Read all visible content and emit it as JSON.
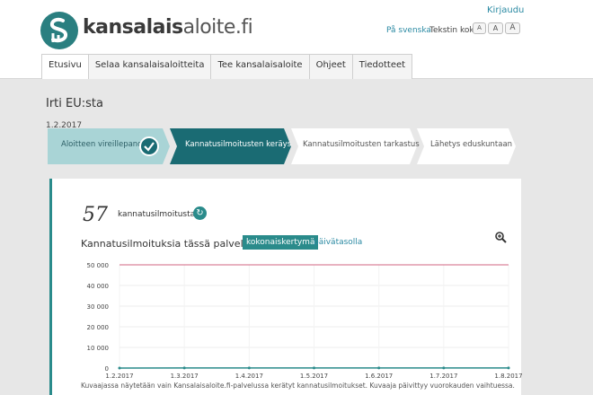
{
  "header": {
    "brand_bold": "kansalais",
    "brand_light": "aloite.fi",
    "login": "Kirjaudu",
    "language_link": "På svenska",
    "text_size_label": "Tekstin koko:",
    "text_size_buttons": [
      "A",
      "A",
      "A"
    ]
  },
  "nav": {
    "items": [
      "Etusivu",
      "Selaa kansalaisaloitteita",
      "Tee kansalaisaloite",
      "Ohjeet",
      "Tiedotteet"
    ]
  },
  "initiative": {
    "title": "Irti EU:sta",
    "date": "1.2.2017"
  },
  "steps": [
    {
      "label": "Aloitteen vireillepano",
      "state": "done"
    },
    {
      "label": "Kannatusilmoitusten keräys",
      "state": "current"
    },
    {
      "label": "Kannatusilmoitusten tarkastus",
      "state": "upcoming"
    },
    {
      "label": "Lähetys eduskuntaan",
      "state": "upcoming"
    }
  ],
  "support": {
    "count": "57",
    "count_label": "kannatusilmoitusta"
  },
  "chart_section": {
    "title": "Kannatusilmoituksia tässä palvelussa 57",
    "tab_active": "kokonaiskertymä",
    "tab_other": "päivätasolla",
    "caption": "Kuvaajassa näytetään vain Kansalaisaloite.fi-palvelussa kerätyt kannatusilmoitukset. Kuvaaja päivittyy vuorokauden vaihtuessa."
  },
  "colors": {
    "teal": "#2a8b8b",
    "dark_teal": "#1a6b73",
    "done_step": "#a9d4d6",
    "target_line": "#d9849a"
  },
  "chart_data": {
    "type": "line",
    "x_tick_labels": [
      "1.2.2017",
      "1.3.2017",
      "1.4.2017",
      "1.5.2017",
      "1.6.2017",
      "1.7.2017",
      "1.8.2017"
    ],
    "y_tick_labels": [
      "0",
      "10 000",
      "20 000",
      "30 000",
      "40 000",
      "50 000"
    ],
    "ylim": [
      0,
      50000
    ],
    "target_line": 50000,
    "series": [
      {
        "x": [
          "1.2.2017",
          "1.3.2017",
          "1.4.2017",
          "1.5.2017",
          "1.6.2017",
          "1.7.2017",
          "1.8.2017"
        ],
        "values": [
          0,
          57,
          57,
          57,
          57,
          57,
          57
        ]
      }
    ],
    "grid": true
  }
}
